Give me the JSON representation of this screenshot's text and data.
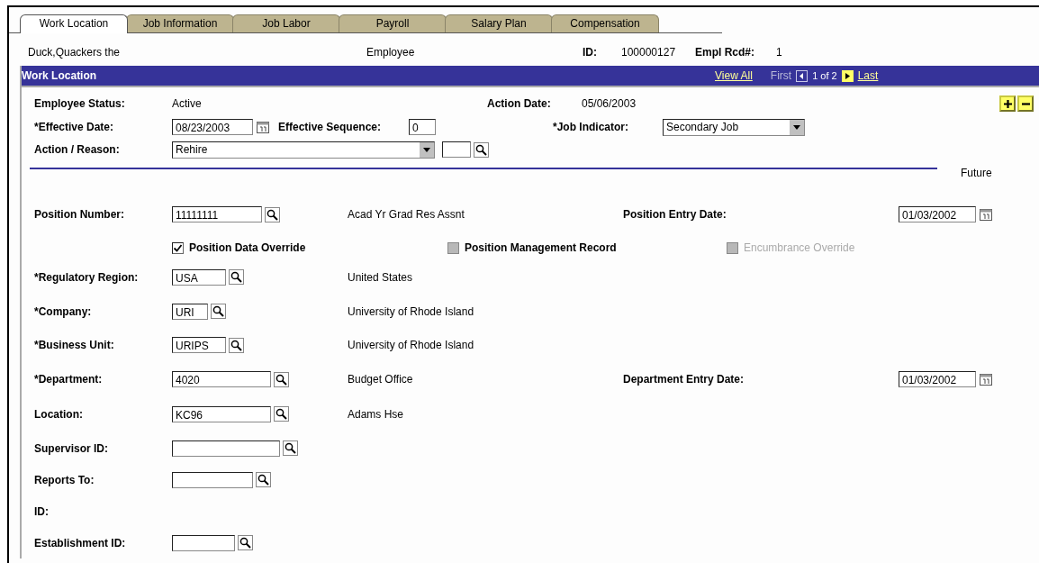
{
  "tabs": [
    {
      "label": "Work Location",
      "selected": true
    },
    {
      "label": "Job Information",
      "selected": false
    },
    {
      "label": "Job Labor",
      "selected": false
    },
    {
      "label": "Payroll",
      "selected": false
    },
    {
      "label": "Salary Plan",
      "selected": false
    },
    {
      "label": "Compensation",
      "selected": false
    }
  ],
  "header": {
    "name": "Duck,Quackers the",
    "role": "Employee",
    "id_label": "ID:",
    "id": "100000127",
    "rcd_label": "Empl Rcd#:",
    "rcd": "1"
  },
  "section": {
    "title": "Work Location",
    "view_all": "View All",
    "first": "First",
    "count": "1 of 2",
    "last": "Last"
  },
  "top": {
    "employee_status": {
      "label": "Employee Status:",
      "value": "Active"
    },
    "action_date": {
      "label": "Action Date:",
      "value": "05/06/2003"
    },
    "effective_date": {
      "label": "*Effective Date:",
      "value": "08/23/2003"
    },
    "effective_sequence": {
      "label": "Effective Sequence:",
      "value": "0"
    },
    "job_indicator": {
      "label": "*Job Indicator:",
      "value": "Secondary Job"
    },
    "action_reason": {
      "label": "Action / Reason:",
      "value": "Rehire"
    }
  },
  "future": "Future",
  "position": {
    "label": "Position Number:",
    "value": "11111111",
    "description": "Acad Yr Grad Res Assnt",
    "entry_label": "Position Entry Date:",
    "entry_date": "01/03/2002"
  },
  "checkboxes": [
    {
      "label": "Position Data Override",
      "checked": true,
      "disabled": false
    },
    {
      "label": "Position Management Record",
      "checked": false,
      "disabled": true
    },
    {
      "label": "Encumbrance Override",
      "checked": false,
      "disabled": true
    }
  ],
  "rows": [
    {
      "kind": "lookup",
      "label": "*Regulatory Region:",
      "value": "USA",
      "description": "United States"
    },
    {
      "kind": "lookup",
      "label": "*Company:",
      "value": "URI",
      "description": "University of Rhode Island"
    },
    {
      "kind": "lookup",
      "label": "*Business Unit:",
      "value": "URIPS",
      "description": "University of Rhode Island"
    },
    {
      "kind": "lookup",
      "label": "*Department:",
      "value": "4020",
      "description": "Budget Office",
      "date_label": "Department Entry Date:",
      "date": "01/03/2002"
    },
    {
      "kind": "lookup",
      "label": "Location:",
      "value": "KC96",
      "description": "Adams Hse"
    },
    {
      "kind": "lookup",
      "label": "Supervisor ID:"
    },
    {
      "kind": "lookup",
      "label": "Reports To:"
    },
    {
      "kind": "label",
      "label": "ID:"
    },
    {
      "kind": "lookup",
      "label": "Establishment ID:"
    }
  ]
}
